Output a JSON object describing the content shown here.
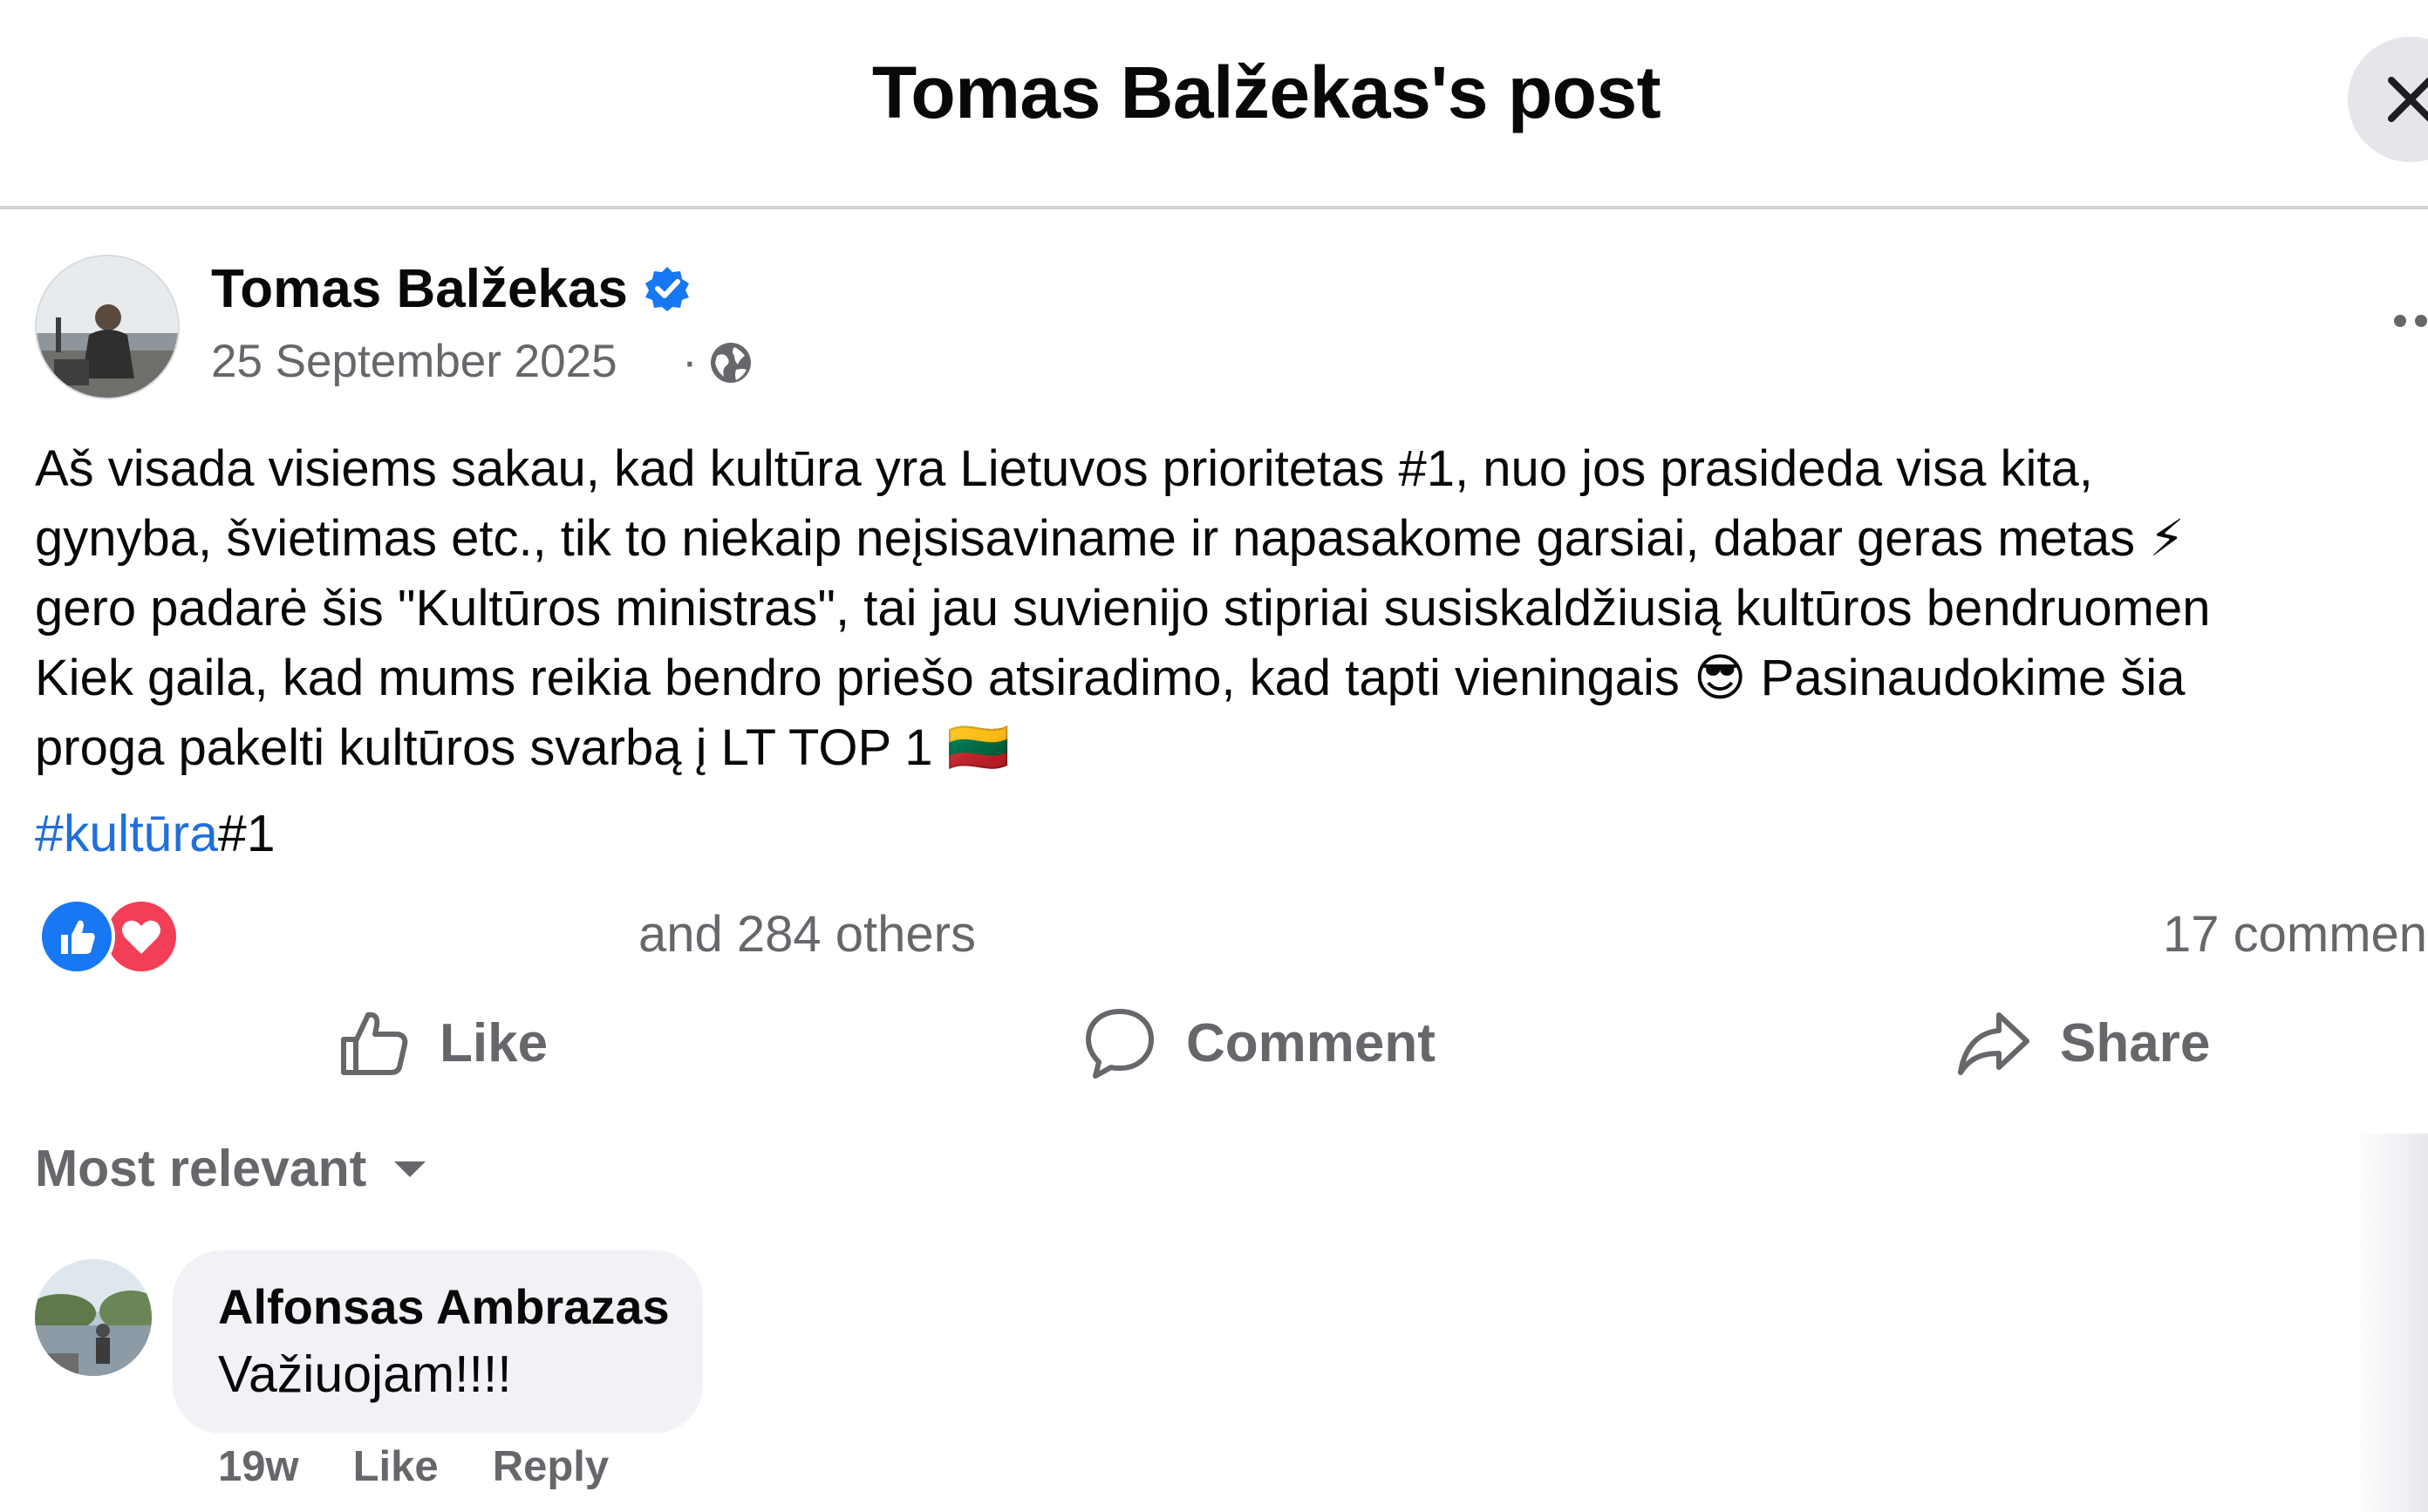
{
  "header": {
    "title": "Tomas Balžekas's post"
  },
  "post": {
    "author": "Tomas Balžekas",
    "date": "25 September 2025",
    "separator": "·",
    "body_lines": [
      "Aš visada visiems sakau, kad kultūra yra Lietuvos prioritetas #1, nuo jos prasideda visa kita,",
      "gynyba, švietimas etc., tik to niekaip neįsisaviname ir napasakome garsiai, dabar geras metas ⚡",
      "gero padarė šis \"Kultūros ministras\", tai jau suvienijo stipriai susiskaldžiusią kultūros bendruomen",
      "Kiek gaila, kad mums reikia bendro priešo atsiradimo, kad tapti vieningais 😎 Pasinaudokime šia",
      "proga pakelti kultūros svarbą į LT TOP 1 🇱🇹"
    ],
    "hashtag": "#kultūra",
    "hashtag_suffix": "#1",
    "reactions_text": "and 284 others",
    "comments_count": "17 commen",
    "icons": {
      "verified": "verified-badge-icon",
      "audience": "globe-icon",
      "more": "more-icon"
    }
  },
  "actions": {
    "like": "Like",
    "comment": "Comment",
    "share": "Share"
  },
  "sort": {
    "label": "Most relevant"
  },
  "comment": {
    "author": "Alfonsas Ambrazas",
    "text": "Važiuojam!!!!",
    "time": "19w",
    "like": "Like",
    "reply": "Reply"
  },
  "colors": {
    "link": "#216fdb",
    "secondary_text": "#65676b",
    "verified": "#1877f2",
    "bubble": "#f0f2f5"
  }
}
